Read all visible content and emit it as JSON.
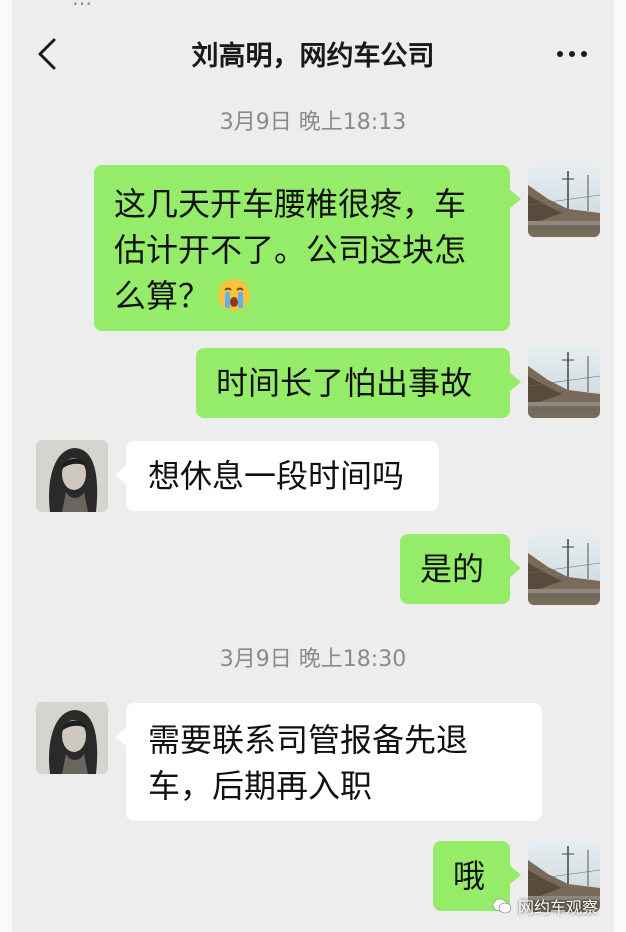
{
  "status_bar": {
    "partial_text": "…"
  },
  "header": {
    "title": "刘高明，网约车公司",
    "back_icon": "back-chevron-icon",
    "more_icon": "more-dots-icon"
  },
  "colors": {
    "background": "#ededed",
    "my_bubble": "#95ec69",
    "their_bubble": "#ffffff"
  },
  "timestamps": [
    "3月9日 晚上18:13",
    "3月9日 晚上18:30"
  ],
  "messages": [
    {
      "from": "me",
      "text": "这几天开车腰椎很疼，车估计开不了。公司这块怎么算？",
      "emoji": "crying-face-icon"
    },
    {
      "from": "me",
      "text": "时间长了怕出事故"
    },
    {
      "from": "other",
      "text": "想休息一段时间吗"
    },
    {
      "from": "me",
      "text": "是的"
    },
    {
      "from": "other",
      "text": "需要联系司管报备先退车，后期再入职"
    },
    {
      "from": "me",
      "text": "哦"
    }
  ],
  "watermark": {
    "text": "网约车观察",
    "icon": "wechat-logo-icon"
  }
}
